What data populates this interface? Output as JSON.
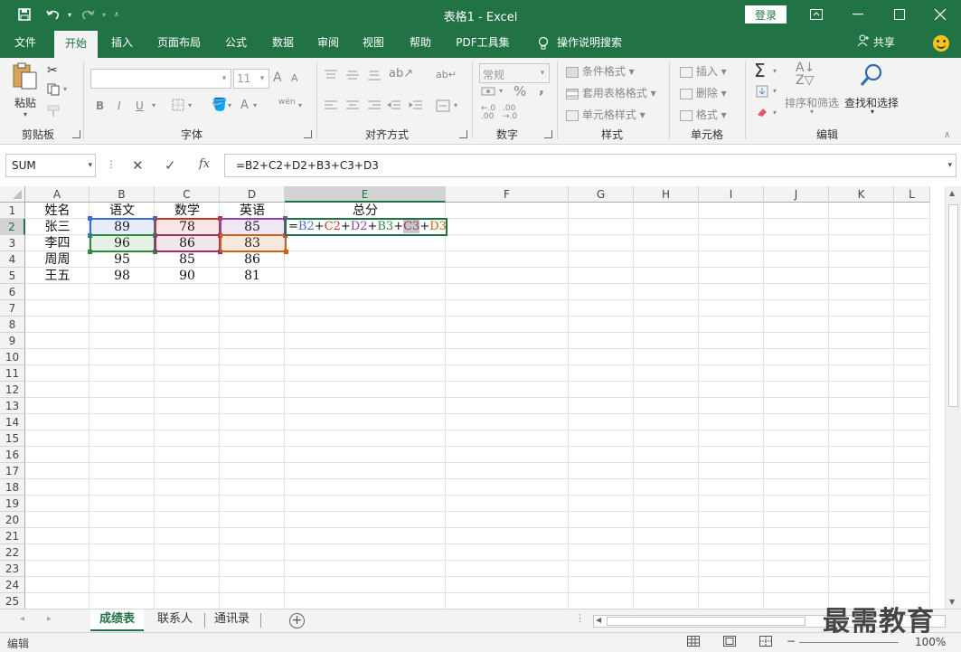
{
  "window": {
    "title": "表格1  -  Excel",
    "login_label": "登录"
  },
  "tabs": [
    {
      "label": "文件",
      "active": false
    },
    {
      "label": "开始",
      "active": true
    },
    {
      "label": "插入",
      "active": false
    },
    {
      "label": "页面布局",
      "active": false
    },
    {
      "label": "公式",
      "active": false
    },
    {
      "label": "数据",
      "active": false
    },
    {
      "label": "审阅",
      "active": false
    },
    {
      "label": "视图",
      "active": false
    },
    {
      "label": "帮助",
      "active": false
    },
    {
      "label": "PDF工具集",
      "active": false
    },
    {
      "label": "操作说明搜索",
      "active": false
    }
  ],
  "share_label": "共享",
  "ribbon": {
    "clipboard": {
      "label": "剪贴板",
      "paste": "粘贴"
    },
    "font": {
      "label": "字体",
      "font_size": "11",
      "bold": "B",
      "italic": "I",
      "underline": "U",
      "grow": "A",
      "shrink": "A",
      "phonetic": "wén"
    },
    "alignment": {
      "label": "对齐方式"
    },
    "number": {
      "label": "数字",
      "format": "常规",
      "percent": "%",
      "comma": ","
    },
    "styles": {
      "label": "样式",
      "conditional": "条件格式",
      "table": "套用表格格式",
      "cell": "单元格样式"
    },
    "cells": {
      "label": "单元格",
      "insert": "插入",
      "delete": "删除",
      "format": "格式"
    },
    "editing": {
      "label": "编辑",
      "sort": "排序和筛选",
      "find": "查找和选择"
    }
  },
  "formula_bar": {
    "name_box": "SUM",
    "formula": "=B2+C2+D2+B3+C3+D3"
  },
  "columns": [
    "A",
    "B",
    "C",
    "D",
    "E",
    "F",
    "G",
    "H",
    "I",
    "J",
    "K",
    "L"
  ],
  "rows": [
    "1",
    "2",
    "3",
    "4",
    "5",
    "6",
    "7",
    "8",
    "9",
    "10",
    "11",
    "12",
    "13",
    "14",
    "15",
    "16",
    "17",
    "18",
    "19",
    "20",
    "21",
    "22",
    "23",
    "24",
    "25"
  ],
  "cells": {
    "A1": "姓名",
    "B1": "语文",
    "C1": "数学",
    "D1": "英语",
    "E1": "总分",
    "A2": "张三",
    "B2": "89",
    "C2": "78",
    "D2": "85",
    "A3": "李四",
    "B3": "96",
    "C3": "86",
    "D3": "83",
    "A4": "周周",
    "B4": "95",
    "C4": "85",
    "D4": "86",
    "A5": "王五",
    "B5": "98",
    "C5": "90",
    "D5": "81"
  },
  "edit_formula_parts": [
    {
      "text": "=",
      "color": "#111111"
    },
    {
      "text": "B2",
      "color": "#3b6fd6"
    },
    {
      "text": "+",
      "color": "#111111"
    },
    {
      "text": "C2",
      "color": "#c0392b"
    },
    {
      "text": "+",
      "color": "#111111"
    },
    {
      "text": "D2",
      "color": "#8e44ad"
    },
    {
      "text": "+",
      "color": "#111111"
    },
    {
      "text": "B3",
      "color": "#2e8b3e"
    },
    {
      "text": "+",
      "color": "#111111"
    },
    {
      "text": "C3",
      "color": "#a0306a"
    },
    {
      "text": "+",
      "color": "#111111"
    },
    {
      "text": "D3",
      "color": "#c86414"
    }
  ],
  "sheets": [
    {
      "label": "成绩表",
      "active": true
    },
    {
      "label": "联系人",
      "active": false
    },
    {
      "label": "通讯录",
      "active": false
    }
  ],
  "status": {
    "mode": "编辑",
    "zoom": "100%"
  },
  "watermark": "最需教育",
  "colors": {
    "excel_green": "#217346"
  }
}
